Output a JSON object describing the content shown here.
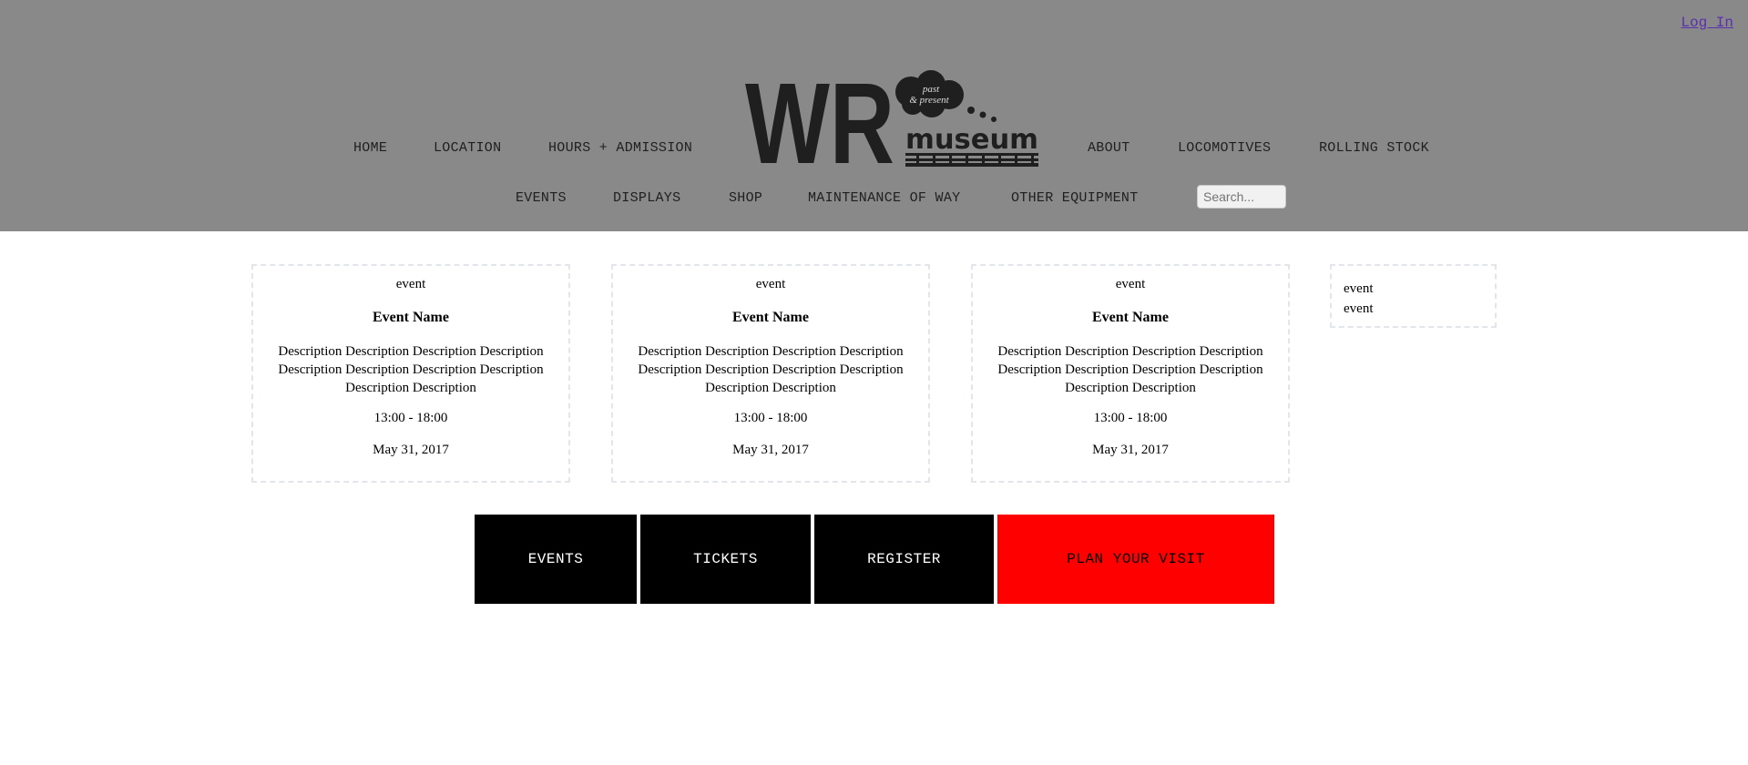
{
  "header": {
    "login_label": "Log In",
    "logo": {
      "wordmark": "WR",
      "cloud_text_1": "past",
      "cloud_text_2": "& present",
      "subtitle": "museum"
    },
    "nav_row1": [
      "HOME",
      "LOCATION",
      "HOURS + ADMISSION",
      "ABOUT",
      "LOCOMOTIVES",
      "ROLLING STOCK"
    ],
    "nav_row2": [
      "EVENTS",
      "DISPLAYS",
      "SHOP",
      "MAINTENANCE OF WAY",
      "OTHER EQUIPMENT"
    ],
    "search_placeholder": "Search..."
  },
  "events": [
    {
      "type": "event",
      "name": "Event Name",
      "description": "Description Description Description Description Description Description Description Description Description Description",
      "time": "13:00 - 18:00",
      "date": "May 31, 2017"
    },
    {
      "type": "event",
      "name": "Event Name",
      "description": "Description Description Description Description Description Description Description Description Description Description",
      "time": "13:00 - 18:00",
      "date": "May 31, 2017"
    },
    {
      "type": "event",
      "name": "Event Name",
      "description": "Description Description Description Description Description Description Description Description Description Description",
      "time": "13:00 - 18:00",
      "date": "May 31, 2017"
    }
  ],
  "sidebar": {
    "items": [
      "event",
      "event"
    ]
  },
  "actions": {
    "events_label": "EVENTS",
    "tickets_label": "TICKETS",
    "register_label": "REGISTER",
    "plan_label": "PLAN YOUR VISIT"
  },
  "colors": {
    "header_bg": "#898989",
    "plan_button_bg": "#ff0000",
    "action_button_bg": "#000000",
    "card_border": "#e2e6ea"
  }
}
